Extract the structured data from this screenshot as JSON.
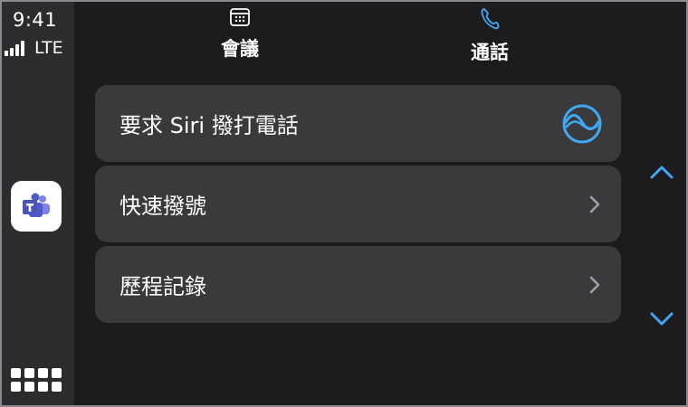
{
  "status": {
    "time": "9:41",
    "network": "LTE"
  },
  "dock": {
    "app_icon": "teams-icon",
    "launcher_icon": "app-grid-icon"
  },
  "tabs": [
    {
      "label": "會議",
      "icon": "calendar-icon"
    },
    {
      "label": "通話",
      "icon": "phone-icon"
    }
  ],
  "list": {
    "items": [
      {
        "label": "要求 Siri 撥打電話",
        "icon": "siri-icon"
      },
      {
        "label": "快速撥號",
        "icon": "chevron-right-icon"
      },
      {
        "label": "歷程記錄",
        "icon": "chevron-right-icon"
      }
    ]
  },
  "colors": {
    "background": "#1c1c1e",
    "dock": "#2c2c2e",
    "row": "#3a3a3c",
    "accent": "#3fa9f5",
    "text": "#ffffff"
  }
}
